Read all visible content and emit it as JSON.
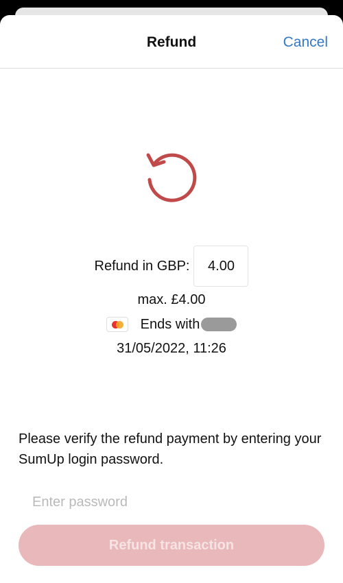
{
  "header": {
    "title": "Refund",
    "cancel_label": "Cancel"
  },
  "refund": {
    "icon": "refund-arrow-icon",
    "icon_color": "#c0494a",
    "amount_label": "Refund in GBP:",
    "amount_value": "4.00",
    "max_text": "max. £4.00",
    "card_brand_icon": "mastercard-icon",
    "card_label": "Ends with",
    "date_text": "31/05/2022, 11:26"
  },
  "verification": {
    "instruction": "Please verify the refund payment by entering your SumUp login password.",
    "password_placeholder": "Enter password",
    "submit_label": "Refund transaction",
    "submit_enabled": false
  },
  "colors": {
    "link": "#3478c6",
    "button_disabled_bg": "#e8b8ba"
  }
}
